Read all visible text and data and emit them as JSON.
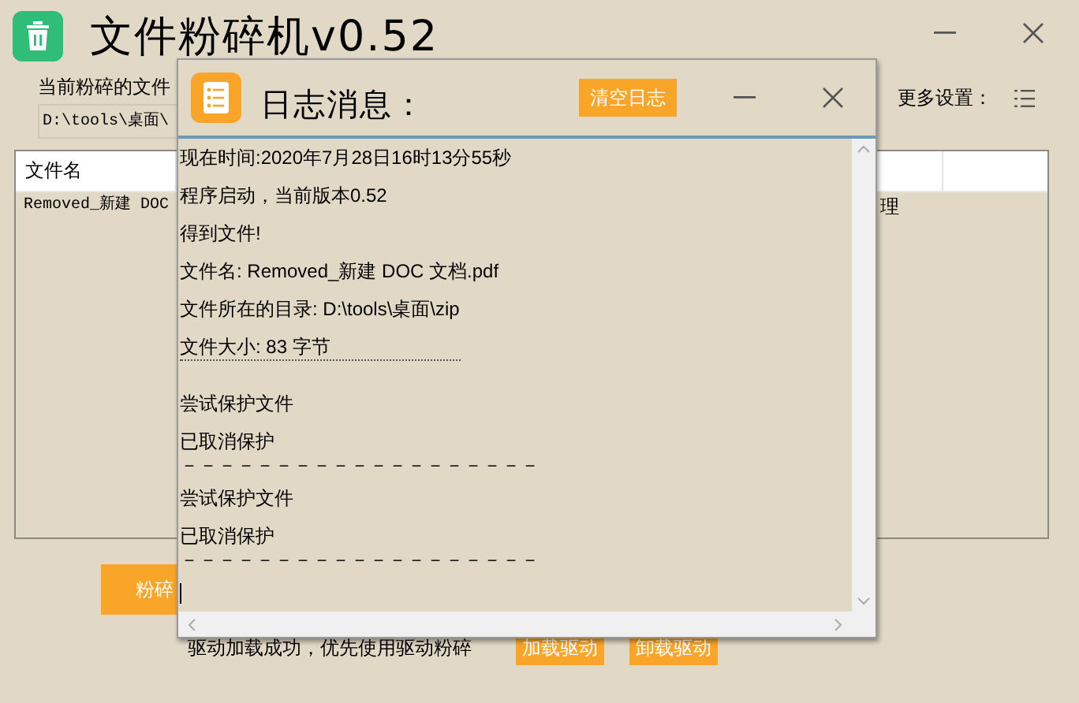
{
  "main_window": {
    "title": "文件粉碎机v0.52",
    "current_file_label": "当前粉碎的文件",
    "current_file_path": "D:\\tools\\桌面\\",
    "more_settings_label": "更多设置：",
    "table": {
      "columns": [
        "文件名"
      ],
      "rows": [
        {
          "cells": [
            "Removed_新建 DOC",
            "理"
          ]
        }
      ]
    },
    "shred_button": "粉碎",
    "driver_status": "驱动加载成功，优先使用驱动粉碎",
    "driver_buttons": [
      "加载驱动",
      "卸载驱动"
    ]
  },
  "log_dialog": {
    "title": "日志消息：",
    "clear_button": "清空日志",
    "lines": [
      {
        "kind": "text",
        "text": "现在时间:2020年7月28日16时13分55秒"
      },
      {
        "kind": "text",
        "text": "程序启动，当前版本0.52"
      },
      {
        "kind": "text",
        "text": "得到文件!"
      },
      {
        "kind": "text",
        "text": "文件名: Removed_新建 DOC 文档.pdf"
      },
      {
        "kind": "text",
        "text": "文件所在的目录: D:\\tools\\桌面\\zip"
      },
      {
        "kind": "dotted",
        "text": "文件大小: 83 字节"
      },
      {
        "kind": "blank"
      },
      {
        "kind": "text",
        "text": "尝试保护文件"
      },
      {
        "kind": "text",
        "text": "已取消保护"
      },
      {
        "kind": "rule",
        "text": "－－－－－－－－－－－－－－－－－－－"
      },
      {
        "kind": "text",
        "text": "尝试保护文件"
      },
      {
        "kind": "text",
        "text": "已取消保护"
      },
      {
        "kind": "rule",
        "text": "－－－－－－－－－－－－－－－－－－－"
      },
      {
        "kind": "caret"
      }
    ]
  }
}
